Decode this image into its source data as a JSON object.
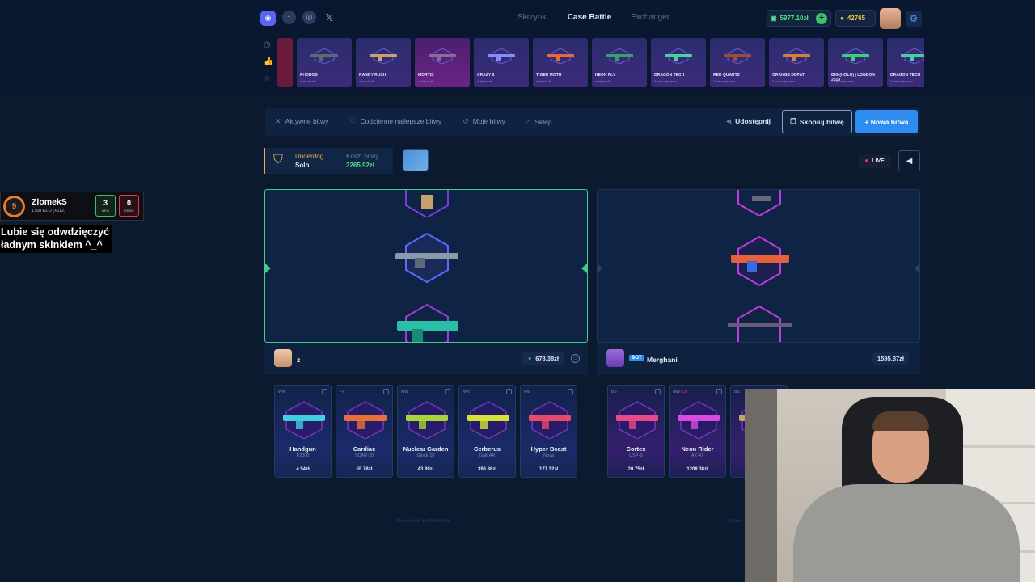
{
  "header": {
    "nav": [
      "Skrzynki",
      "Case Battle",
      "Exchanger"
    ],
    "active_nav": "Case Battle",
    "balance": "5977.10zł",
    "coins": "42765"
  },
  "recent_drops": [
    {
      "name": "PHOBOS",
      "sub": "w tej chwili",
      "color": "purple"
    },
    {
      "name": "RANDY RUSH",
      "sub": "w tej chwili",
      "color": "purple"
    },
    {
      "name": "MORTIS",
      "sub": "w tej chwili",
      "color": "pink"
    },
    {
      "name": "CRAZY 8",
      "sub": "w tej chwili",
      "color": "purple"
    },
    {
      "name": "TIGER MOTH",
      "sub": "w tej chwili",
      "color": "purple"
    },
    {
      "name": "NEON PLY",
      "sub": "w tej chwili",
      "color": "purple"
    },
    {
      "name": "DRAGON TECH",
      "sub": "2 sekundy temu",
      "color": "purple"
    },
    {
      "name": "RED QUARTZ",
      "sub": "2 sekundy temu",
      "color": "purple"
    },
    {
      "name": "ORANGE DDPAT",
      "sub": "2 sekundy temu",
      "color": "purple"
    },
    {
      "name": "BIG (HOLO) | LONDON 2018",
      "sub": "2 sekundy temu",
      "color": "purple"
    },
    {
      "name": "DRAGON TECH",
      "sub": "2 sekundy temu",
      "color": "purple"
    }
  ],
  "tabs": {
    "active_battles": "Aktywne bitwy",
    "daily_best": "Codzienne najlepsze bitwy",
    "my_battles": "Moje bitwy",
    "shop": "Sklep"
  },
  "actions": {
    "share": "Udostępnij",
    "copy": "Skopiuj bitwę",
    "new": "+ Nowa bitwa"
  },
  "battle": {
    "mode": "Underdog",
    "type": "Solo",
    "cost_label": "Koszt bitwy",
    "cost": "3265.92zł",
    "live": "LIVE"
  },
  "players": [
    {
      "name": "z",
      "total": "678.38zł",
      "items": [
        {
          "wear": "WW",
          "name": "Handgun",
          "model": "P2000",
          "price": "4.54zł",
          "color": "#3fd0e0"
        },
        {
          "wear": "FT",
          "name": "Cardiac",
          "model": "SCAR-20",
          "price": "55.78zł",
          "color": "#e8703a"
        },
        {
          "wear": "MW",
          "name": "Nuclear Garden",
          "model": "Glock-18",
          "price": "43.89zł",
          "color": "#a8d63a"
        },
        {
          "wear": "MW",
          "name": "Cerberus",
          "model": "Galil AR",
          "price": "396.86zł",
          "color": "#d4e23a"
        },
        {
          "wear": "FN",
          "name": "Hyper Beast",
          "model": "Nova",
          "price": "177.32zł",
          "color": "#e84a6a"
        }
      ]
    },
    {
      "name": "Merghani",
      "bot": "BOT",
      "total": "1595.37zł",
      "items": [
        {
          "wear": "BS",
          "name": "Cortex",
          "model": "USP-S",
          "price": "20.75zł",
          "color": "#e84a8a"
        },
        {
          "wear": "MW",
          "st": "ST",
          "name": "Neon Rider",
          "model": "AK-47",
          "price": "1208.38zł",
          "color": "#d84ae0"
        },
        {
          "wear": "BS",
          "name": "In",
          "model": "",
          "price": "",
          "color": "#c8a060"
        }
      ]
    }
  ],
  "footer": {
    "left": "Client Seed: 8a7f6d5e4c3b",
    "right": "Client"
  },
  "stream_overlay": {
    "level": "9",
    "name": "ZlomekS",
    "elo": "1758 ELO (+112)",
    "wins": "3",
    "wins_label": "wins",
    "losses": "0",
    "losses_label": "losses",
    "caption_line1": "Lubie się odwdzięczyć",
    "caption_line2": "ładnym skinkiem ^_^"
  },
  "colors": {
    "accent": "#2d8cf0",
    "green": "#3fcf8a",
    "gold": "#e6b04a",
    "background": "#0c1a2f"
  }
}
